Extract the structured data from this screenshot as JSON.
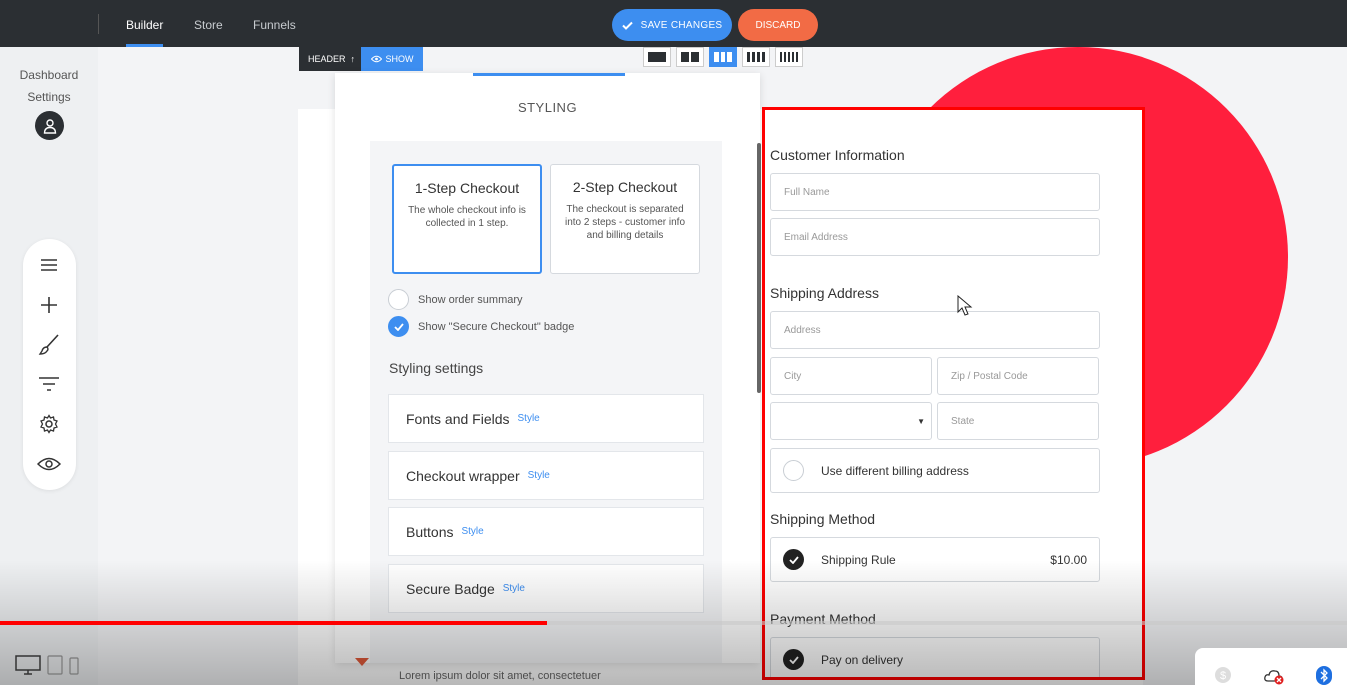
{
  "topbar": {
    "tabs": [
      {
        "label": "Builder",
        "active": true
      },
      {
        "label": "Store",
        "active": false
      },
      {
        "label": "Funnels",
        "active": false
      }
    ],
    "save_label": "SAVE CHANGES",
    "discard_label": "DISCARD"
  },
  "sidebar": {
    "dashboard": "Dashboard",
    "settings": "Settings",
    "tools": [
      "menu-icon",
      "plus-icon",
      "brush-icon",
      "filter-icon",
      "gear-icon",
      "eye-icon"
    ]
  },
  "canvas_toolbar": {
    "header_label": "HEADER",
    "show_label": "SHOW"
  },
  "styling_panel": {
    "title": "STYLING",
    "steps": [
      {
        "title": "1-Step Checkout",
        "desc": "The whole checkout info is collected in 1 step.",
        "selected": true
      },
      {
        "title": "2-Step Checkout",
        "desc": "The checkout is separated into 2 steps - customer info and billing details",
        "selected": false
      }
    ],
    "options": [
      {
        "label": "Show order summary",
        "checked": false
      },
      {
        "label": "Show \"Secure Checkout\" badge",
        "checked": true
      }
    ],
    "settings_title": "Styling settings",
    "settings": [
      {
        "name": "Fonts and Fields",
        "style": "Style"
      },
      {
        "name": "Checkout wrapper",
        "style": "Style"
      },
      {
        "name": "Buttons",
        "style": "Style"
      },
      {
        "name": "Secure Badge",
        "style": "Style"
      }
    ]
  },
  "checkout_form": {
    "customer_title": "Customer Information",
    "full_name_ph": "Full Name",
    "email_ph": "Email Address",
    "shipping_title": "Shipping Address",
    "address_ph": "Address",
    "city_ph": "City",
    "zip_ph": "Zip / Postal Code",
    "state_ph": "State",
    "billing_label": "Use different billing address",
    "shipping_method_title": "Shipping Method",
    "shipping_rule": "Shipping Rule",
    "shipping_price": "$10.00",
    "payment_title": "Payment Method",
    "payment_option": "Pay on delivery"
  },
  "page_text": {
    "lorem": "Lorem ipsum dolor sit amet, consectetuer"
  },
  "video": {
    "progress": 0.406
  },
  "colors": {
    "accent": "#3d8ef0",
    "discard": "#f26b45",
    "highlight": "#ff0000",
    "hero_circle": "#ff1f3d"
  }
}
